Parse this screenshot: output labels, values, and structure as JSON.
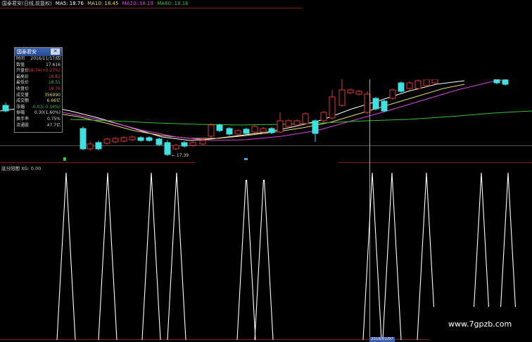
{
  "header": {
    "title": "国泰君安(日线,前复权)",
    "ma5": "MA5: 18.76",
    "ma10": "MA10: 18.45",
    "ma20": "MA20: 18.19",
    "ma60": "MA60: 18.16"
  },
  "colors": {
    "ma5": "#ffffff",
    "ma10": "#e8d96a",
    "ma20": "#e040e0",
    "ma60": "#38c038",
    "up_candle": "#e03838",
    "down_candle": "#40e0e0",
    "subchart_line": "#ffffff"
  },
  "info_box": {
    "title": "国泰君安",
    "close_label": "✕",
    "rows": [
      {
        "label": "时间",
        "value": "2016/11/17/四",
        "color": "#d8d8d8"
      },
      {
        "label": "数值",
        "value": "17.616",
        "color": "#d8d8d8"
      },
      {
        "label": "开盘价",
        "value": "18.74(+0.27%)",
        "color": "#e03838"
      },
      {
        "label": "最高价",
        "value": "18.81",
        "color": "#e03838"
      },
      {
        "label": "最低价",
        "value": "18.51",
        "color": "#38c038"
      },
      {
        "label": "收盘价",
        "value": "18.76",
        "color": "#e03838"
      },
      {
        "label": "成交量",
        "value": "356990",
        "color": "#e0e040"
      },
      {
        "label": "成交额",
        "value": "6.66亿",
        "color": "#e0e040"
      },
      {
        "label": "涨幅",
        "value": "-0.03(-0.16%)",
        "color": "#38c038"
      },
      {
        "label": "振幅",
        "value": "0.30(1.60%)",
        "color": "#d8d8d8"
      },
      {
        "label": "换手率",
        "value": "0.75%",
        "color": "#d8d8d8"
      },
      {
        "label": "流通股",
        "value": "47.7亿",
        "color": "#d8d8d8"
      }
    ]
  },
  "annotations": {
    "low_price": "← 17.39"
  },
  "subchart": {
    "label": "底分阳图 XG: 0.00"
  },
  "bottom_axis": {
    "highlight_date": "2016/01/07"
  },
  "watermark": "www.7gpzb.com"
}
